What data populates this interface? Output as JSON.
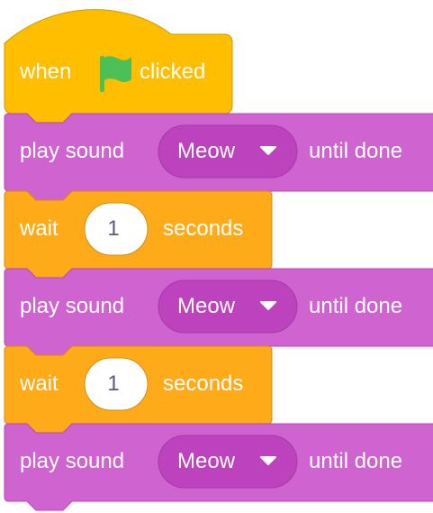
{
  "script": {
    "hat_block": {
      "label_before": "when",
      "icon": "green-flag-icon",
      "label_after": "clicked"
    },
    "blocks": [
      {
        "type": "play_sound_until_done",
        "prefix": "play sound",
        "sound": "Meow",
        "suffix": "until done"
      },
      {
        "type": "wait",
        "prefix": "wait",
        "value": "1",
        "suffix": "seconds"
      },
      {
        "type": "play_sound_until_done",
        "prefix": "play sound",
        "sound": "Meow",
        "suffix": "until done"
      },
      {
        "type": "wait",
        "prefix": "wait",
        "value": "1",
        "suffix": "seconds"
      },
      {
        "type": "play_sound_until_done",
        "prefix": "play sound",
        "sound": "Meow",
        "suffix": "until done"
      }
    ]
  },
  "colors": {
    "events": "#ffbf00",
    "events_border": "#cc9900",
    "sound": "#cf63cf",
    "sound_border": "#bd42bd",
    "sound_dropdown": "#bd42bd",
    "control": "#ffab19",
    "control_border": "#cf8b17",
    "flag": "#4cbf56",
    "input_text": "#575e75"
  }
}
